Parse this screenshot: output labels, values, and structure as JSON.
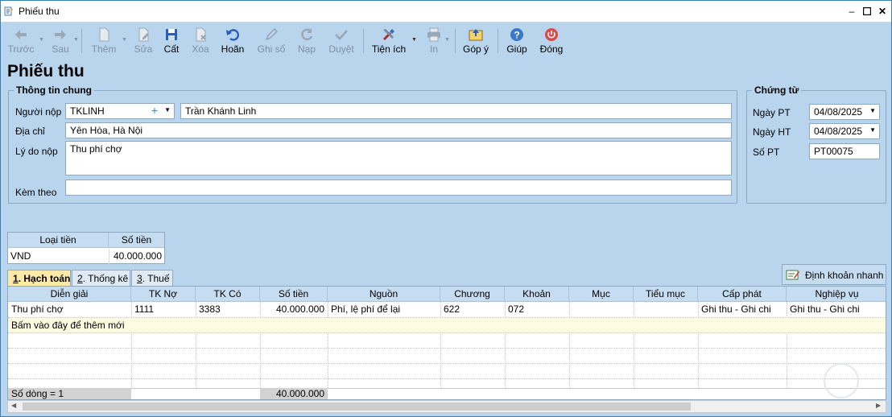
{
  "window": {
    "title": "Phiếu thu"
  },
  "toolbar": [
    {
      "id": "prev",
      "label": "Trước",
      "icon": "arrow-left-icon",
      "enabled": false,
      "dropdown": true
    },
    {
      "id": "next",
      "label": "Sau",
      "icon": "arrow-right-icon",
      "enabled": false,
      "dropdown": true
    },
    {
      "id": "add",
      "label": "Thêm",
      "icon": "new-document-icon",
      "enabled": false,
      "dropdown": true
    },
    {
      "id": "edit",
      "label": "Sửa",
      "icon": "edit-document-icon",
      "enabled": false,
      "dropdown": false
    },
    {
      "id": "save",
      "label": "Cất",
      "icon": "save-icon",
      "enabled": true,
      "dropdown": false
    },
    {
      "id": "delete",
      "label": "Xóa",
      "icon": "delete-document-icon",
      "enabled": false,
      "dropdown": false
    },
    {
      "id": "undo",
      "label": "Hoãn",
      "icon": "undo-icon",
      "enabled": true,
      "dropdown": false
    },
    {
      "id": "post",
      "label": "Ghi sổ",
      "icon": "pencil-icon",
      "enabled": false,
      "dropdown": false
    },
    {
      "id": "reload",
      "label": "Nạp",
      "icon": "refresh-icon",
      "enabled": false,
      "dropdown": false
    },
    {
      "id": "approve",
      "label": "Duyệt",
      "icon": "checkmark-icon",
      "enabled": false,
      "dropdown": false
    },
    {
      "id": "utilities",
      "label": "Tiện ích",
      "icon": "tools-icon",
      "enabled": true,
      "dropdown": true
    },
    {
      "id": "print",
      "label": "In",
      "icon": "printer-icon",
      "enabled": false,
      "dropdown": true
    },
    {
      "id": "feedback",
      "label": "Góp ý",
      "icon": "feedback-icon",
      "enabled": true,
      "dropdown": false
    },
    {
      "id": "help",
      "label": "Giúp",
      "icon": "help-icon",
      "enabled": true,
      "dropdown": false
    },
    {
      "id": "close",
      "label": "Đóng",
      "icon": "power-icon",
      "enabled": true,
      "dropdown": false
    }
  ],
  "page_title": "Phiếu thu",
  "general": {
    "legend": "Thông tin chung",
    "payer_label": "Người nộp",
    "payer_code": "TKLINH",
    "payer_name": "Trần Khánh Linh",
    "address_label": "Địa chỉ",
    "address": "Yên Hòa, Hà Nội",
    "reason_label": "Lý do nộp",
    "reason": "Thu phí chợ",
    "attach_label": "Kèm theo",
    "attach": ""
  },
  "voucher": {
    "legend": "Chứng từ",
    "date_pt_label": "Ngày PT",
    "date_pt": "04/08/2025",
    "date_ht_label": "Ngày HT",
    "date_ht": "04/08/2025",
    "number_label": "Số PT",
    "number": "PT00075"
  },
  "currency": {
    "col_type": "Loại tiền",
    "col_amount": "Số tiền",
    "type": "VND",
    "amount": "40.000.000"
  },
  "tabs": [
    {
      "num": "1",
      "label": ". Hạch toán",
      "active": true
    },
    {
      "num": "2",
      "label": ". Thống kê",
      "active": false
    },
    {
      "num": "3",
      "label": ". Thuế",
      "active": false
    }
  ],
  "quick_entry_label": "Định khoản nhanh",
  "grid": {
    "columns": [
      "Diễn giải",
      "TK Nợ",
      "TK Có",
      "Số tiền",
      "Nguồn",
      "Chương",
      "Khoản",
      "Mục",
      "Tiểu mục",
      "Cấp phát",
      "Nghiệp vụ"
    ],
    "rows": [
      [
        "Thu phí chợ",
        "1111",
        "3383",
        "40.000.000",
        "Phí, lệ phí để lại",
        "622",
        "072",
        "",
        "",
        "Ghi thu - Ghi chi",
        "Ghi thu - Ghi chi"
      ]
    ],
    "new_row_hint": "Bấm vào đây để thêm mới",
    "row_count": "Số dòng = 1",
    "total_amount": "40.000.000"
  }
}
